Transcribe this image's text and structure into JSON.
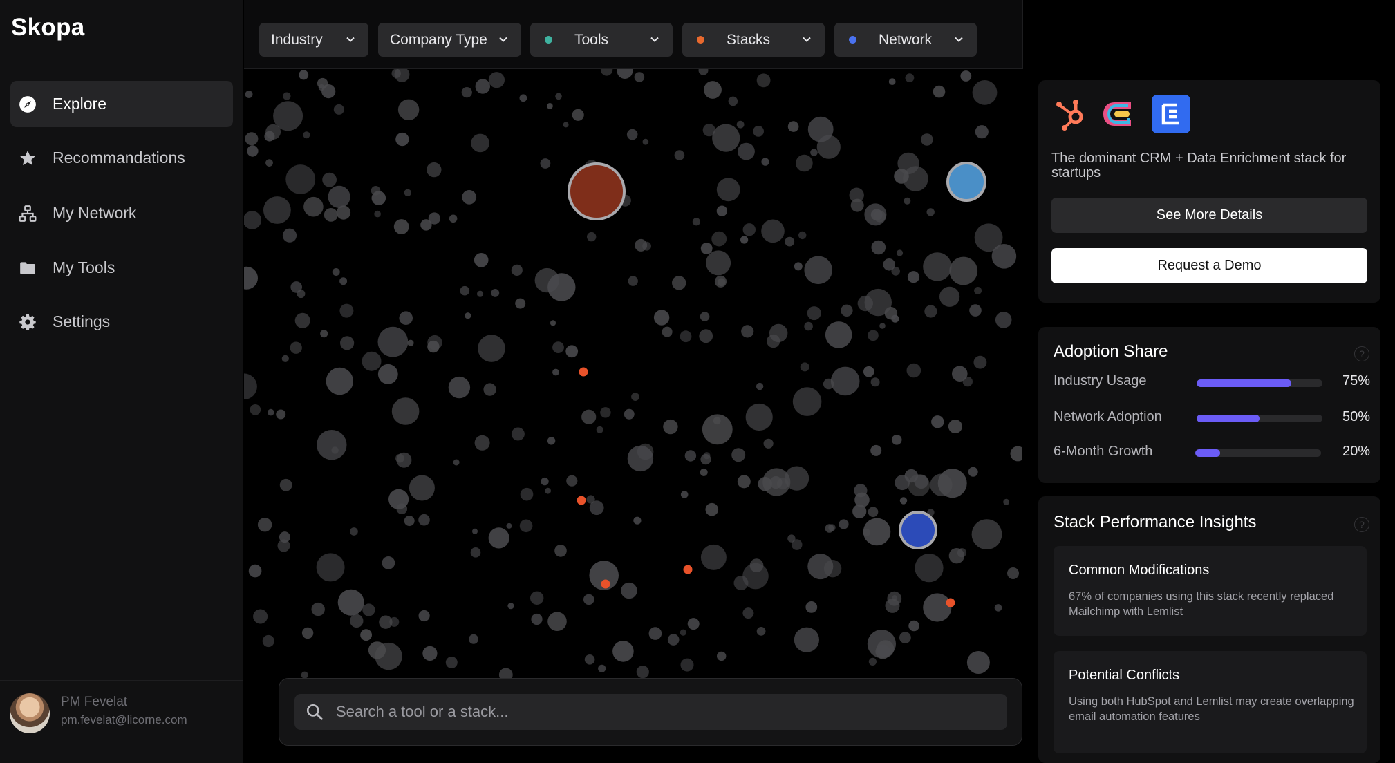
{
  "app": {
    "name": "Skopa"
  },
  "sidebar": {
    "items": [
      {
        "label": "Explore",
        "icon": "compass-icon",
        "active": true
      },
      {
        "label": "Recommandations",
        "icon": "star-icon",
        "active": false
      },
      {
        "label": "My Network",
        "icon": "network-icon",
        "active": false
      },
      {
        "label": "My Tools",
        "icon": "folder-icon",
        "active": false
      },
      {
        "label": "Settings",
        "icon": "gear-icon",
        "active": false
      }
    ],
    "user": {
      "name": "PM Fevelat",
      "email": "pm.fevelat@licorne.com"
    }
  },
  "filters": [
    {
      "label": "Industry",
      "dot_color": null
    },
    {
      "label": "Company Type",
      "dot_color": null
    },
    {
      "label": "Tools",
      "dot_color": "#3fb2a0"
    },
    {
      "label": "Stacks",
      "dot_color": "#e8692e"
    },
    {
      "label": "Network",
      "dot_color": "#4a72f0"
    }
  ],
  "search": {
    "placeholder": "Search a tool or a stack..."
  },
  "stack_card": {
    "logos": [
      "hubspot-logo",
      "clay-logo",
      "lemlist-logo"
    ],
    "description": "The dominant CRM + Data Enrichment stack for startups",
    "see_more_label": "See More Details",
    "request_demo_label": "Request a Demo"
  },
  "adoption": {
    "title": "Adoption Share",
    "metrics": [
      {
        "label": "Industry Usage",
        "value": "75%",
        "fraction": 0.75
      },
      {
        "label": "Network Adoption",
        "value": "50%",
        "fraction": 0.5
      },
      {
        "label": "6-Month Growth",
        "value": "20%",
        "fraction": 0.2
      }
    ]
  },
  "insights": {
    "title": "Stack Performance Insights",
    "items": [
      {
        "title": "Common Modifications",
        "body": "67% of companies using this stack recently replaced Mailchimp with Lemlist"
      },
      {
        "title": "Potential Conflicts",
        "body": "Using both HubSpot and Lemlist may create overlapping email automation features"
      }
    ]
  },
  "colors": {
    "accent": "#6b5cf6",
    "stack_node": "#7f2e1a",
    "tool_node": "#4a8fc7",
    "network_node": "#2c4bb8",
    "stack_dot": "#e8522a"
  }
}
